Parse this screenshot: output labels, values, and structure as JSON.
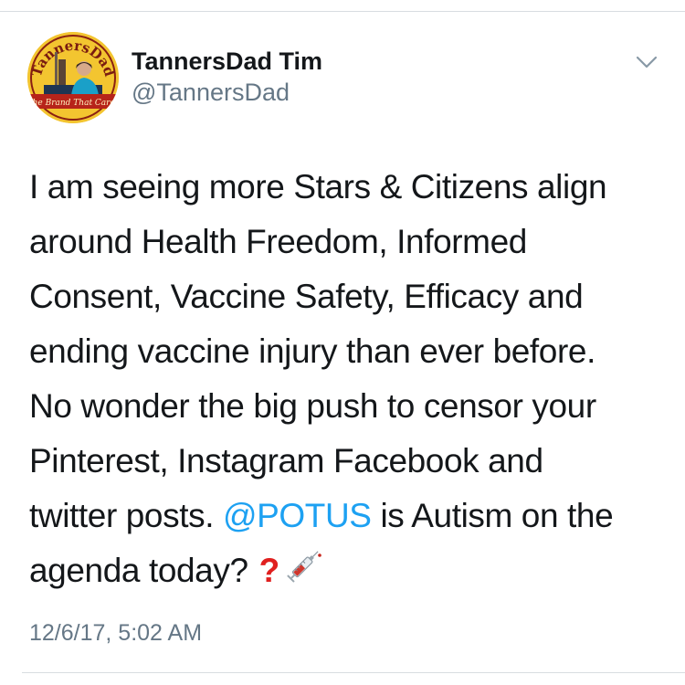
{
  "tweet": {
    "author": {
      "display_name": "TannersDad Tim",
      "handle": "@TannersDad",
      "avatar_text_top": "TannersDad",
      "avatar_text_banner": "The Brand That Cares"
    },
    "text_lines": [
      "I am seeing more Stars & Citizens align",
      "around Health Freedom, Informed",
      "Consent, Vaccine Safety, Efficacy and",
      "ending vaccine injury than ever before.",
      "No wonder the big push to censor your",
      "Pinterest, Instagram Facebook and"
    ],
    "line7": {
      "before_mention": "twitter posts. ",
      "mention": "@POTUS",
      "after_mention": " is Autism on the"
    },
    "line8": {
      "text": "agenda today?",
      "emoji_question": "❓",
      "emoji_syringe": "syringe-icon"
    },
    "timestamp": "12/6/17, 5:02 AM"
  },
  "colors": {
    "text": "#14171a",
    "secondary": "#657786",
    "link": "#1da1f2",
    "divider": "#d8dde1"
  }
}
